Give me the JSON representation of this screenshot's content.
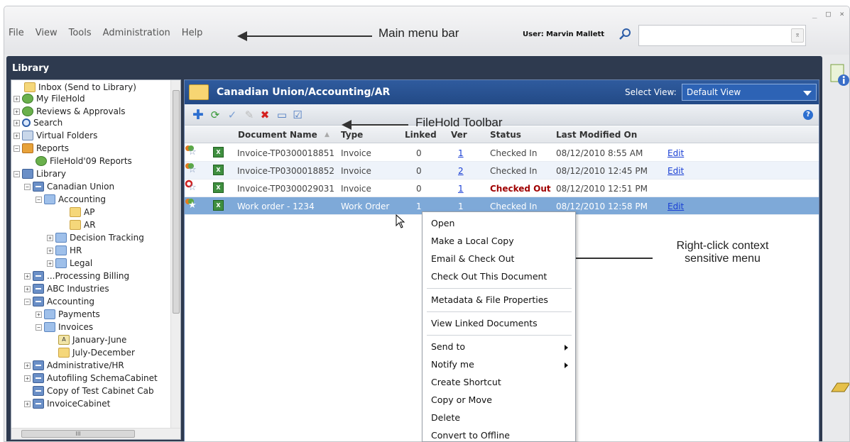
{
  "menu": [
    "File",
    "View",
    "Tools",
    "Administration",
    "Help"
  ],
  "user_label": "User:",
  "user_name": "Marvin Mallett",
  "window_controls": "_ □ ×",
  "annotations": {
    "menu_bar": "Main menu bar",
    "toolbar": "FileHold Toolbar",
    "context_line1": "Right-click context",
    "context_line2": "sensitive menu"
  },
  "library_title": "Library",
  "tree": [
    {
      "label": "Inbox (Send to Library)",
      "icon": "inbox-folder-icon"
    },
    {
      "label": "My FileHold",
      "icon": "my-filehold-icon"
    },
    {
      "label": "Reviews & Approvals",
      "icon": "reviews-icon"
    },
    {
      "label": "Search",
      "icon": "search-icon"
    },
    {
      "label": "Virtual Folders",
      "icon": "virtual-folders-icon"
    },
    {
      "label": "Reports",
      "icon": "reports-icon"
    },
    {
      "label": "FileHold'09 Reports",
      "icon": "report-icon"
    },
    {
      "label": "Library",
      "icon": "library-icon"
    },
    {
      "label": "Canadian Union",
      "icon": "cabinet-icon"
    },
    {
      "label": "Accounting",
      "icon": "drawer-icon"
    },
    {
      "label": "AP",
      "icon": "folder-icon"
    },
    {
      "label": "AR",
      "icon": "folder-icon"
    },
    {
      "label": "Decision Tracking",
      "icon": "drawer-icon"
    },
    {
      "label": "HR",
      "icon": "drawer-icon"
    },
    {
      "label": "Legal",
      "icon": "drawer-icon"
    },
    {
      "label": "...Processing Billing",
      "icon": "cabinet-icon"
    },
    {
      "label": "ABC Industries",
      "icon": "cabinet-icon"
    },
    {
      "label": "Accounting",
      "icon": "cabinet-icon"
    },
    {
      "label": "Payments",
      "icon": "drawer-icon"
    },
    {
      "label": "Invoices",
      "icon": "drawer-icon"
    },
    {
      "label": "January-June",
      "icon": "folder-icon"
    },
    {
      "label": "July-December",
      "icon": "folder-icon"
    },
    {
      "label": "Administrative/HR",
      "icon": "cabinet-icon"
    },
    {
      "label": "Autofiling SchemaCabinet",
      "icon": "cabinet-icon"
    },
    {
      "label": "Copy of Test Cabinet Cab",
      "icon": "cabinet-icon"
    },
    {
      "label": "InvoiceCabinet",
      "icon": "cabinet-icon"
    }
  ],
  "breadcrumb": "Canadian Union/Accounting/AR",
  "select_view_label": "Select View:",
  "select_view_value": "Default View",
  "columns": {
    "name": "Document Name",
    "type": "Type",
    "linked": "Linked",
    "ver": "Ver",
    "status": "Status",
    "modified": "Last Modified On"
  },
  "rows": [
    {
      "name": "Invoice-TP0300018851",
      "type": "Invoice",
      "linked": "0",
      "ver": "1",
      "status": "Checked In",
      "modified": "08/12/2010 8:55 AM",
      "edit": "Edit"
    },
    {
      "name": "Invoice-TP0300018852",
      "type": "Invoice",
      "linked": "0",
      "ver": "2",
      "status": "Checked In",
      "modified": "08/12/2010 12:45 PM",
      "edit": "Edit"
    },
    {
      "name": "Invoice-TP0300029031",
      "type": "Invoice",
      "linked": "0",
      "ver": "1",
      "status": "Checked Out",
      "modified": "08/12/2010 12:51 PM",
      "edit": ""
    },
    {
      "name": "Work order - 1234",
      "type": "Work Order",
      "linked": "1",
      "ver": "1",
      "status": "Checked In",
      "modified": "08/12/2010 12:58 PM",
      "edit": "Edit"
    }
  ],
  "context_menu": {
    "open": "Open",
    "local_copy": "Make a Local Copy",
    "email_checkout": "Email & Check Out",
    "check_out": "Check Out This Document",
    "metadata": "Metadata & File Properties",
    "view_linked": "View Linked Documents",
    "send_to": "Send to",
    "notify_me": "Notify me",
    "create_shortcut": "Create Shortcut",
    "copy_move": "Copy or Move",
    "delete": "Delete",
    "convert_offline": "Convert to Offline"
  },
  "colors": {
    "frame": "#2e3a4f",
    "header_blue": "#2f5b9e",
    "selected_row": "#7ea9d8",
    "checked_out": "#a00000",
    "link": "#1b40d4"
  }
}
